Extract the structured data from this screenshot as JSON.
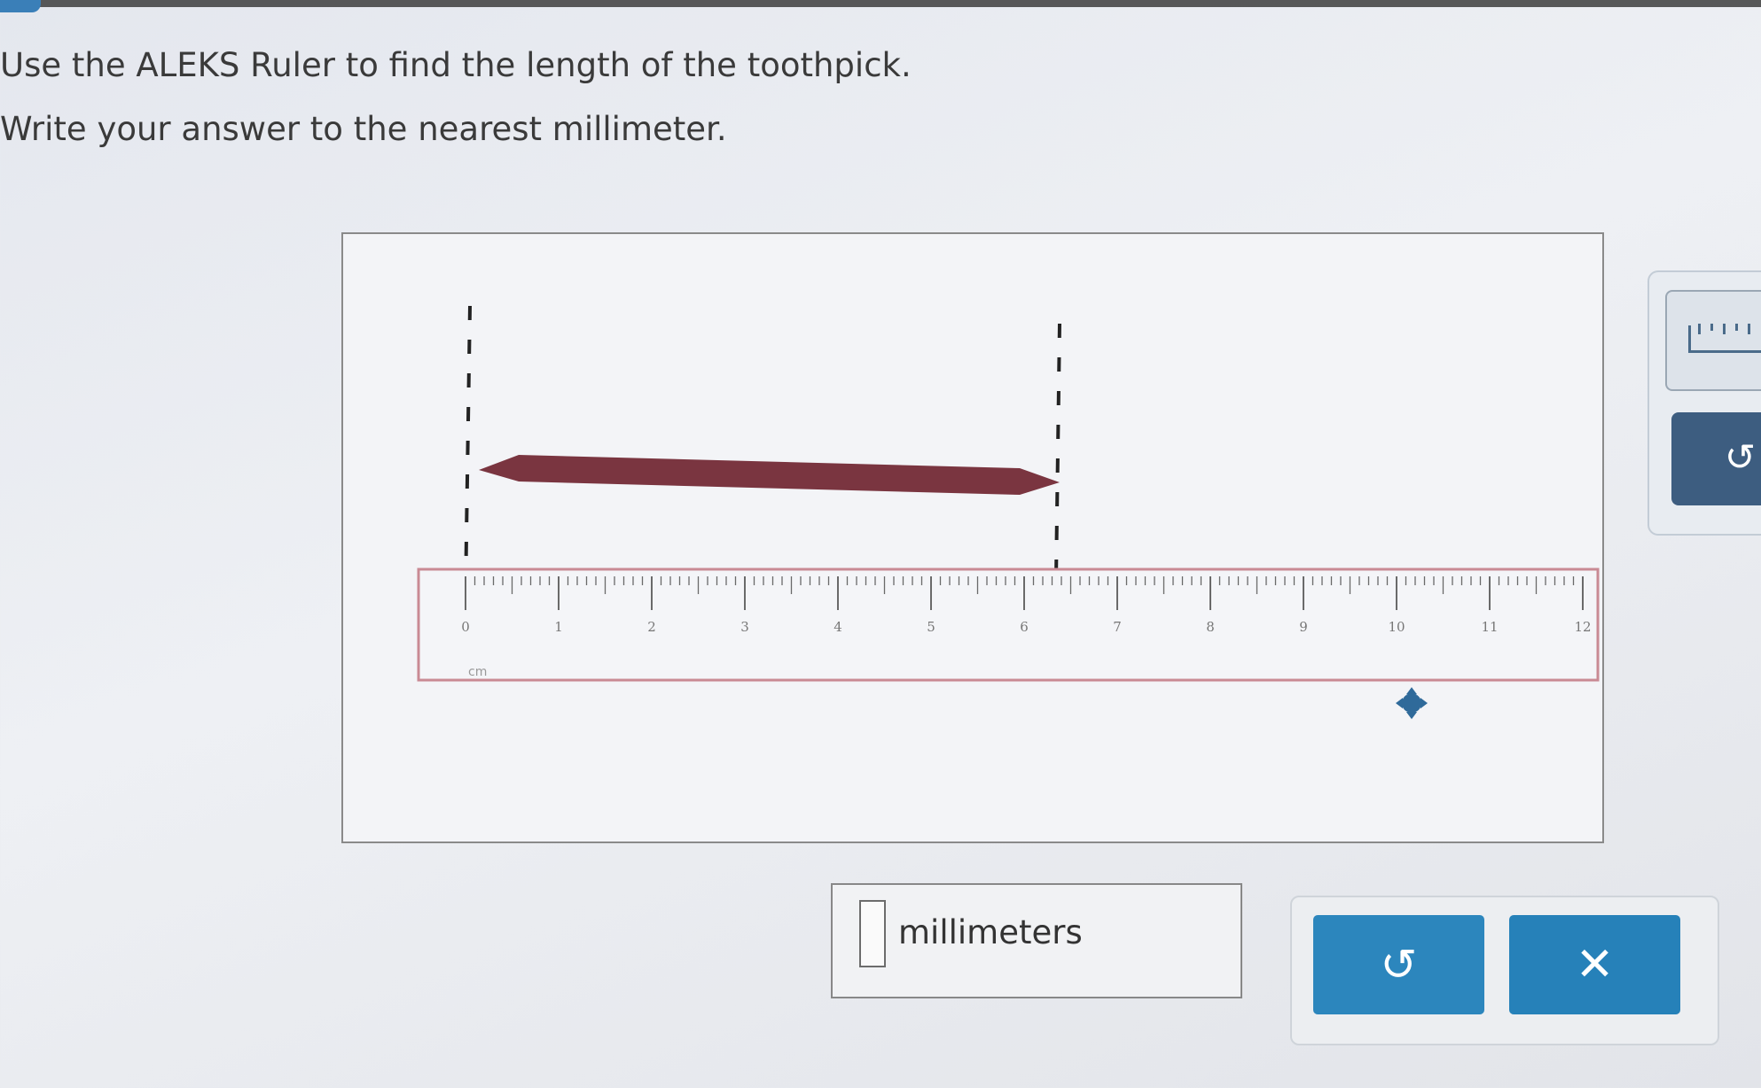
{
  "instructions": {
    "line1": "Use the ALEKS Ruler to find the length of the toothpick.",
    "line2": "Write your answer to the nearest millimeter."
  },
  "ruler": {
    "unit_label": "cm",
    "tick_labels": [
      "0",
      "1",
      "2",
      "3",
      "4",
      "5",
      "6",
      "7",
      "8",
      "9",
      "10",
      "11",
      "12"
    ]
  },
  "answer": {
    "value": "",
    "unit": "millimeters"
  },
  "buttons": {
    "undo_glyph": "↺",
    "clear_glyph": "✕",
    "tool_undo_glyph": "↺"
  },
  "icons": {
    "ruler_tool": "ruler-icon",
    "move_handle": "move-handle-icon"
  },
  "colors": {
    "toothpick": "#7a3540",
    "ruler_border": "#c98a94",
    "button_blue": "#2c86bd",
    "tool_dark": "#3d5d80"
  }
}
